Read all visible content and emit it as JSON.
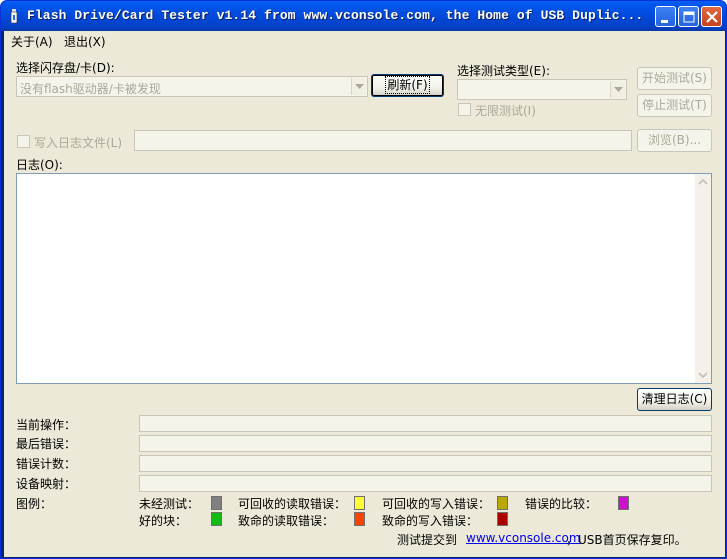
{
  "window": {
    "title": "Flash Drive/Card Tester v1.14 from www.vconsole.com, the Home of USB Duplic..."
  },
  "menu": {
    "about": "关于(A)",
    "exit": "退出(X)"
  },
  "drive": {
    "label": "选择闪存盘/卡(D):",
    "value": "没有flash驱动器/卡被发现",
    "refresh_button": "刷新(F)"
  },
  "test_type": {
    "label": "选择测试类型(E):",
    "value": "",
    "infinite_label": "无限测试(I)",
    "start_button": "开始测试(S)",
    "stop_button": "停止测试(T)"
  },
  "logfile": {
    "checkbox_label": "写入日志文件(L)",
    "path": "",
    "browse_button": "浏览(B)..."
  },
  "log": {
    "label": "日志(O):",
    "content": "",
    "clear_button": "清理日志(C)"
  },
  "status": {
    "current_op_label": "当前操作：",
    "last_error_label": "最后错误：",
    "error_count_label": "错误计数：",
    "device_map_label": "设备映射："
  },
  "legend": {
    "title": "图例：",
    "items": [
      {
        "label": "未经测试：",
        "color": "#808080"
      },
      {
        "label": "可回收的读取错误：",
        "color": "#ffff33"
      },
      {
        "label": "可回收的写入错误：",
        "color": "#b8a800"
      },
      {
        "label": "错误的比较：",
        "color": "#cc11cc"
      },
      {
        "label": "好的块：",
        "color": "#11bb11"
      },
      {
        "label": "致命的读取错误：",
        "color": "#ff4400"
      },
      {
        "label": "致命的写入错误：",
        "color": "#aa0000"
      }
    ]
  },
  "footer": {
    "submit_text": "测试提交到",
    "link_text": "www.vconsole.com",
    "suffix_text": "，USB首页保存复印。"
  },
  "colors": {
    "title_bar": "#0349db",
    "client_bg": "#ece9d8",
    "disabled_text": "#aca899"
  },
  "icons": [
    "app-icon",
    "minimize-icon",
    "maximize-icon",
    "close-icon",
    "dropdown-arrow-icon",
    "scroll-up-icon",
    "scroll-down-icon"
  ]
}
